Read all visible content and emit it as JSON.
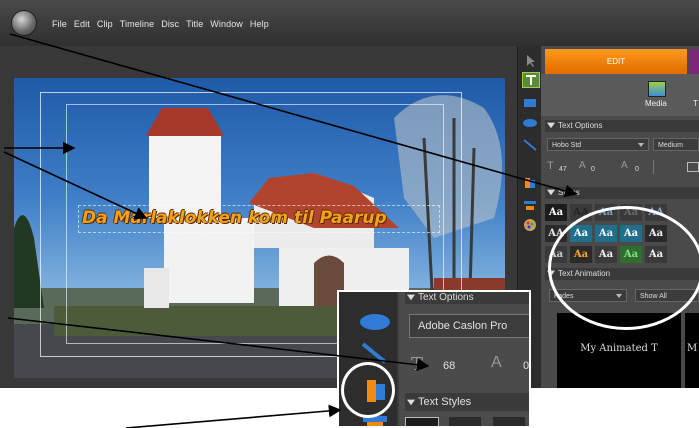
{
  "menu": [
    "File",
    "Edit",
    "Clip",
    "Timeline",
    "Disc",
    "Title",
    "Window",
    "Help"
  ],
  "canvas": {
    "title_text": "Da Marlaklokken kom til Paarup"
  },
  "panel": {
    "tab_edit": "EDIT",
    "media_label": "Media",
    "media_next_initial": "T",
    "text_options_header": "Text Options",
    "font_value": "Hobo Std",
    "weight_value": "Medium",
    "font_size": "47",
    "leading": "0",
    "kerning": "0",
    "styles_header": "Styles",
    "animation_header": "Text Animation",
    "filter_value": "Fades",
    "show_value": "Show All",
    "preview_label": "My Animated T",
    "preview_label_2": "M",
    "swatches": [
      {
        "glyph": "Aa",
        "bg": "#1c1c1c",
        "fg": "#ffffff"
      },
      {
        "glyph": "AA",
        "bg": "#3a3a3a",
        "fg": "#222222"
      },
      {
        "glyph": "Aa",
        "bg": "#3a3a3a",
        "fg": "#7a9ac8"
      },
      {
        "glyph": "Aa",
        "bg": "#3a3a3a",
        "fg": "#6a6a6a"
      },
      {
        "glyph": "AA",
        "bg": "#3a3a3a",
        "fg": "#8aa0c0"
      },
      {
        "glyph": "AA",
        "bg": "#2a2a2a",
        "fg": "#e6e6e6"
      },
      {
        "glyph": "Aa",
        "bg": "#1f6e8c",
        "fg": "#ffffff"
      },
      {
        "glyph": "Aa",
        "bg": "#1f6e8c",
        "fg": "#f0f0f0"
      },
      {
        "glyph": "Aa",
        "bg": "#1f6e8c",
        "fg": "#ffffff"
      },
      {
        "glyph": "Aa",
        "bg": "#2a2a2a",
        "fg": "#f0f0f0"
      },
      {
        "glyph": "Aa",
        "bg": "#3a3a3a",
        "fg": "#cccccc"
      },
      {
        "glyph": "Aa",
        "bg": "#2a2a2a",
        "fg": "#ffa21c"
      },
      {
        "glyph": "Aa",
        "bg": "#3a3a3a",
        "fg": "#f0f0f0"
      },
      {
        "glyph": "Aa",
        "bg": "#2f6e2f",
        "fg": "#7ee07e"
      },
      {
        "glyph": "Aa",
        "bg": "#3a3a3a",
        "fg": "#f0f0f0"
      }
    ]
  },
  "zoom": {
    "text_options_header": "Text Options",
    "font_value": "Adobe Caslon Pro",
    "font_size": "68",
    "leading": "0",
    "styles_header": "Text Styles"
  },
  "colors": {
    "accent": "#f08a10",
    "panel": "#4a4a4a",
    "menubar": "#2f2f2f"
  }
}
